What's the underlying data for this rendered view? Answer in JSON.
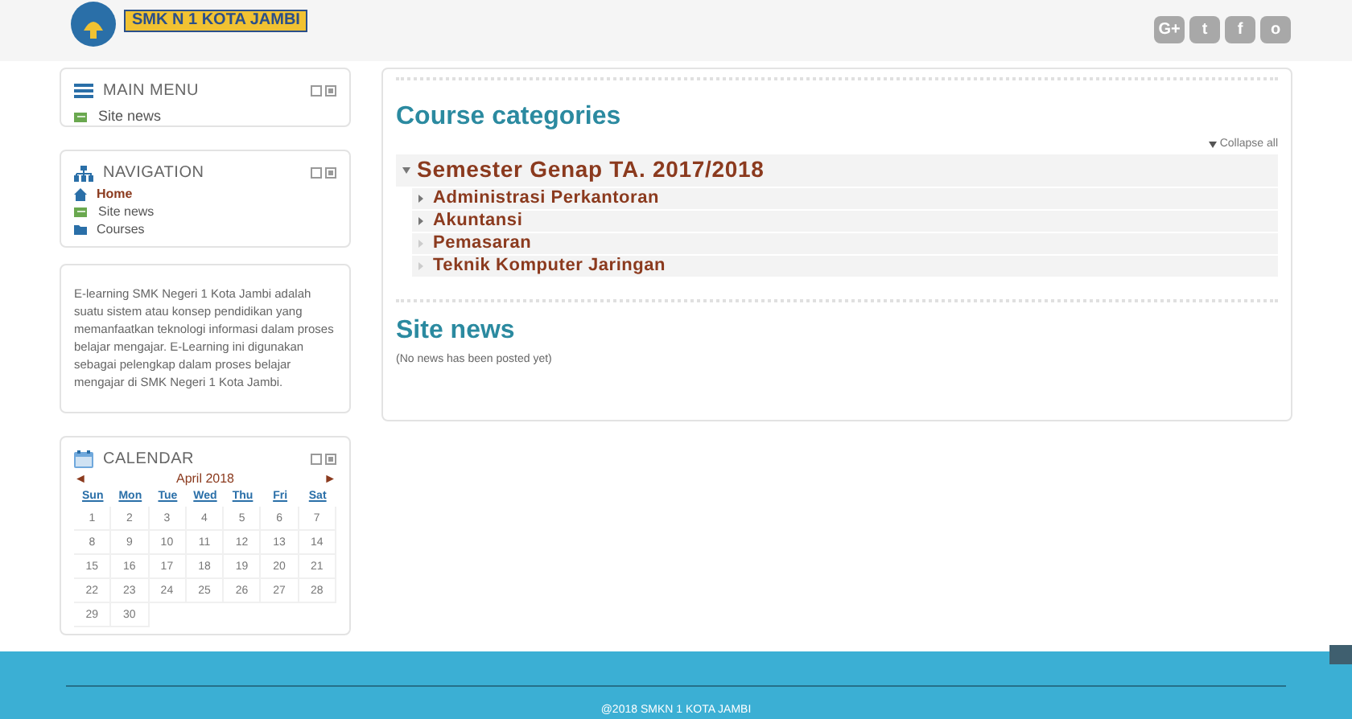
{
  "header": {
    "school": "SMK N 1 KOTA JAMBI",
    "social": [
      "G+",
      "t",
      "f",
      "o"
    ]
  },
  "main_menu": {
    "title": "MAIN MENU",
    "items": [
      {
        "label": "Site news",
        "kind": "news"
      }
    ]
  },
  "navigation": {
    "title": "NAVIGATION",
    "items": [
      {
        "label": "Home",
        "kind": "home",
        "selected": true
      },
      {
        "label": "Site news",
        "kind": "news",
        "selected": false
      },
      {
        "label": "Courses",
        "kind": "folder",
        "selected": false
      }
    ]
  },
  "about": {
    "text": "E-learning SMK Negeri 1 Kota Jambi adalah suatu sistem atau konsep pendidikan yang memanfaatkan teknologi informasi dalam proses belajar mengajar. E-Learning ini digunakan sebagai pelengkap dalam proses belajar mengajar di SMK Negeri 1 Kota Jambi."
  },
  "calendar": {
    "title": "CALENDAR",
    "prev": "◄",
    "next": "►",
    "month": "April 2018",
    "weekdays": [
      "Sun",
      "Mon",
      "Tue",
      "Wed",
      "Thu",
      "Fri",
      "Sat"
    ],
    "days": [
      "1",
      "2",
      "3",
      "4",
      "5",
      "6",
      "7",
      "8",
      "9",
      "10",
      "11",
      "12",
      "13",
      "14",
      "15",
      "16",
      "17",
      "18",
      "19",
      "20",
      "21",
      "22",
      "23",
      "24",
      "25",
      "26",
      "27",
      "28",
      "29",
      "30"
    ]
  },
  "course_categories": {
    "title": "Course categories",
    "collapse_all": "Collapse all",
    "category": {
      "name": "Semester Genap TA. 2017/2018",
      "expanded": true,
      "children": [
        {
          "name": "Administrasi Perkantoran",
          "has_children": true
        },
        {
          "name": "Akuntansi",
          "has_children": true
        },
        {
          "name": "Pemasaran",
          "has_children": false
        },
        {
          "name": "Teknik Komputer Jaringan",
          "has_children": false
        }
      ]
    }
  },
  "site_news": {
    "title": "Site news",
    "empty": "(No news has been posted yet)"
  },
  "footer": {
    "copyright": "@2018 SMKN 1 KOTA JAMBI"
  }
}
